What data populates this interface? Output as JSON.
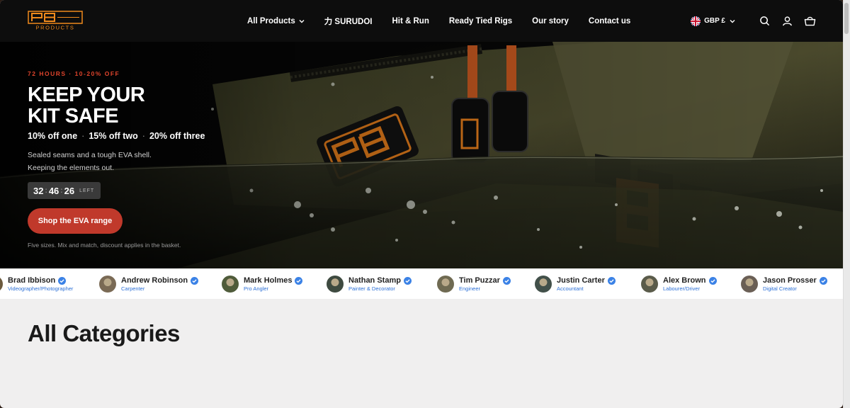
{
  "header": {
    "logo_text": "PB PRODUCTS",
    "nav": [
      {
        "label": "All Products",
        "has_dropdown": true
      },
      {
        "label": "力 SURUDOI",
        "has_dropdown": false
      },
      {
        "label": "Hit & Run",
        "has_dropdown": false
      },
      {
        "label": "Ready Tied Rigs",
        "has_dropdown": false
      },
      {
        "label": "Our story",
        "has_dropdown": false
      },
      {
        "label": "Contact us",
        "has_dropdown": false
      }
    ],
    "currency": "GBP £",
    "icons": [
      "union-jack-flag-icon",
      "chevron-down-icon",
      "search-icon",
      "account-icon",
      "basket-icon"
    ]
  },
  "hero": {
    "kicker": "72 HOURS · 10-20% OFF",
    "headline_line1": "KEEP YOUR",
    "headline_line2": "KIT SAFE",
    "offers": [
      "10% off one",
      "15% off two",
      "20% off three"
    ],
    "offer_separator": "·",
    "description_line1": "Sealed seams and a tough EVA shell.",
    "description_line2": "Keeping the elements out.",
    "countdown": {
      "hours": "32",
      "minutes": "46",
      "seconds": "26",
      "suffix": "LEFT",
      "separator": ":"
    },
    "cta_label": "Shop the EVA range",
    "fineprint": "Five sizes. Mix and match, discount applies in the basket.",
    "accent_color": "#c0392b"
  },
  "creators": [
    {
      "name": "Brad Ibbison",
      "role": "Videographer/Photographer",
      "verified": true
    },
    {
      "name": "Andrew Robinson",
      "role": "Carpenter",
      "verified": true
    },
    {
      "name": "Mark Holmes",
      "role": "Pro Angler",
      "verified": true
    },
    {
      "name": "Nathan Stamp",
      "role": "Painter & Decorator",
      "verified": true
    },
    {
      "name": "Tim Puzzar",
      "role": "Engineer",
      "verified": true
    },
    {
      "name": "Justin Carter",
      "role": "Accountant",
      "verified": true
    },
    {
      "name": "Alex Brown",
      "role": "Labourer/Driver",
      "verified": true
    },
    {
      "name": "Jason Prosser",
      "role": "Digital Creator",
      "verified": true
    }
  ],
  "section": {
    "title": "All Categories"
  },
  "colors": {
    "brand_orange": "#f08a1c",
    "verified_blue": "#2b6fd6",
    "header_bg": "#0d0d0d"
  }
}
